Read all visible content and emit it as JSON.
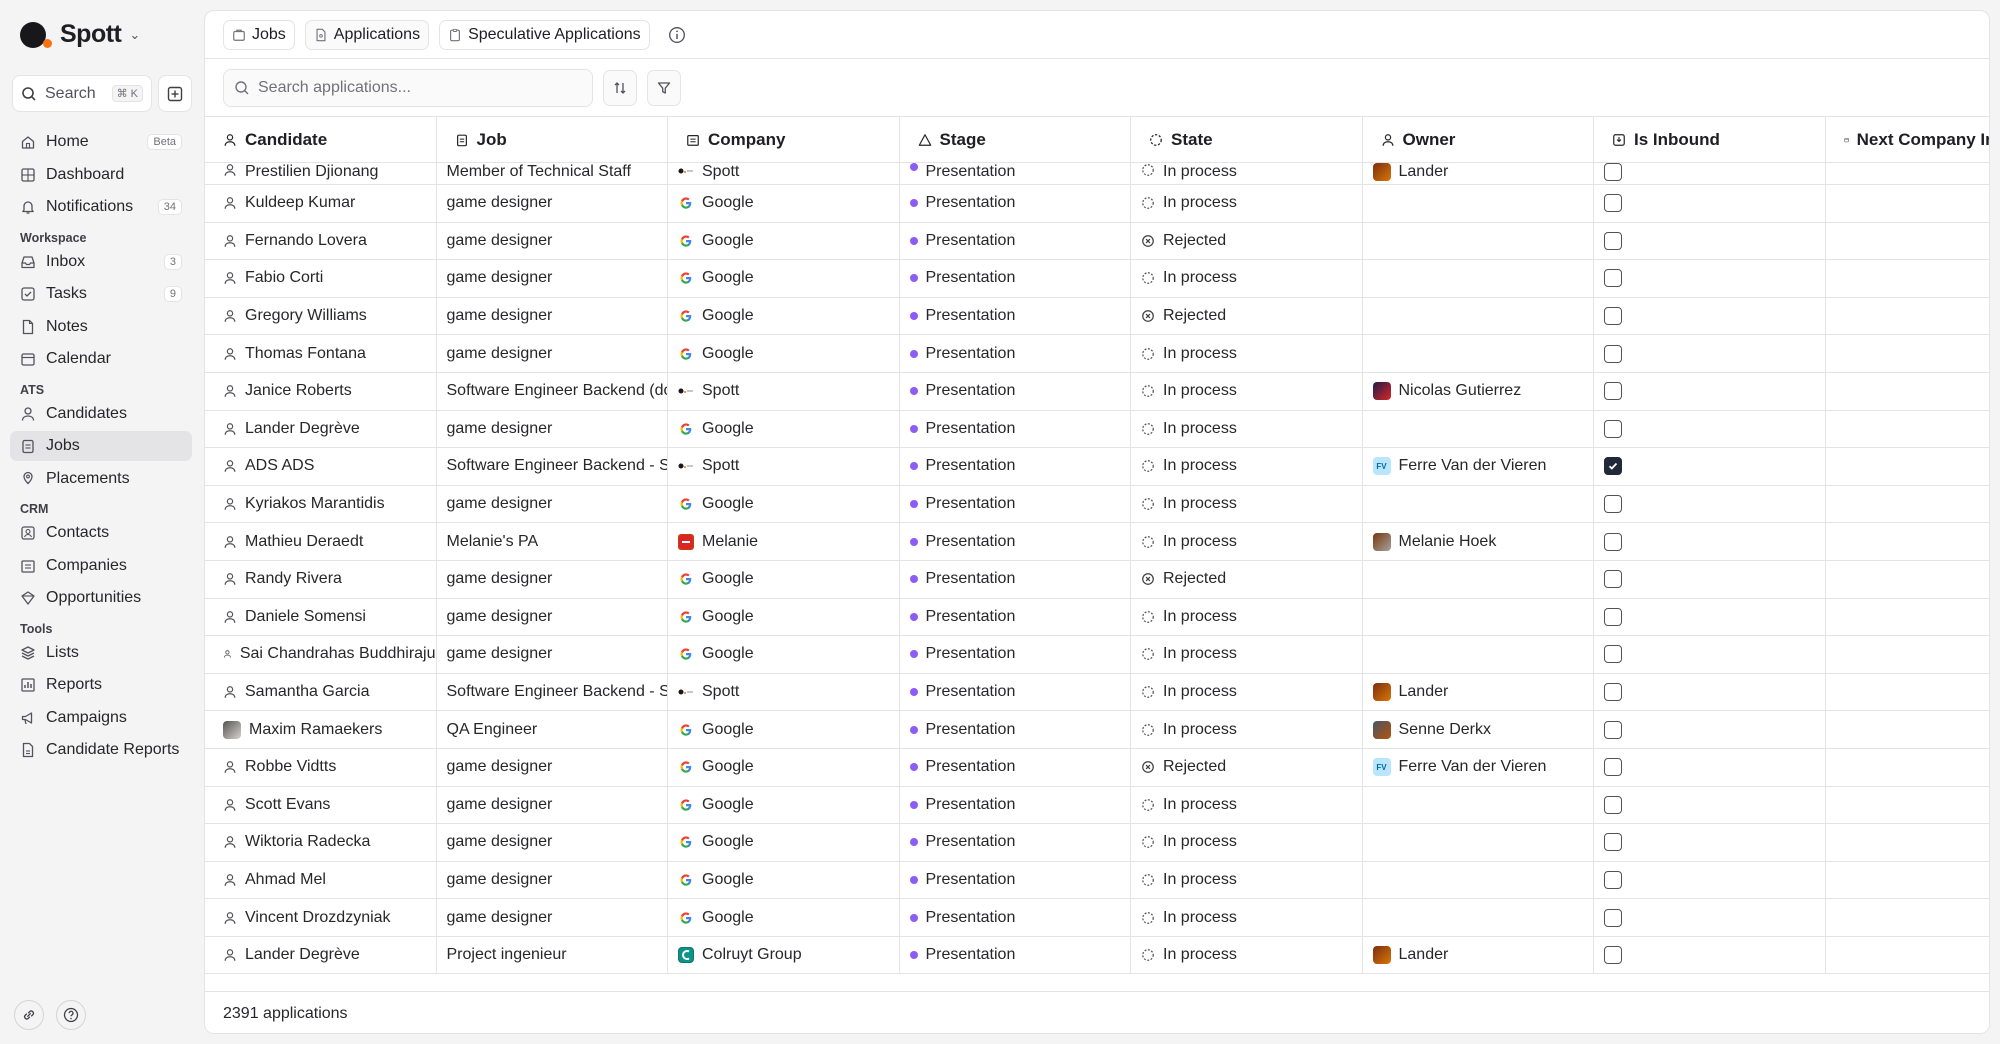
{
  "brand": {
    "name": "Spott"
  },
  "sidebar": {
    "search_label": "Search",
    "search_shortcut": "⌘ K",
    "items_top": [
      {
        "label": "Home",
        "badge": "Beta",
        "icon": "home-icon"
      },
      {
        "label": "Dashboard",
        "badge": "",
        "icon": "dashboard-icon"
      },
      {
        "label": "Notifications",
        "badge": "34",
        "icon": "bell-icon"
      }
    ],
    "sections": [
      {
        "title": "Workspace",
        "items": [
          {
            "label": "Inbox",
            "badge": "3"
          },
          {
            "label": "Tasks",
            "badge": "9"
          },
          {
            "label": "Notes",
            "badge": ""
          },
          {
            "label": "Calendar",
            "badge": ""
          }
        ]
      },
      {
        "title": "ATS",
        "items": [
          {
            "label": "Candidates",
            "badge": ""
          },
          {
            "label": "Jobs",
            "badge": "",
            "active": true
          },
          {
            "label": "Placements",
            "badge": ""
          }
        ]
      },
      {
        "title": "CRM",
        "items": [
          {
            "label": "Contacts",
            "badge": ""
          },
          {
            "label": "Companies",
            "badge": ""
          },
          {
            "label": "Opportunities",
            "badge": ""
          }
        ]
      },
      {
        "title": "Tools",
        "items": [
          {
            "label": "Lists",
            "badge": ""
          },
          {
            "label": "Reports",
            "badge": ""
          },
          {
            "label": "Campaigns",
            "badge": ""
          },
          {
            "label": "Candidate Reports",
            "badge": ""
          }
        ]
      }
    ]
  },
  "tabs": [
    {
      "label": "Jobs"
    },
    {
      "label": "Applications"
    },
    {
      "label": "Speculative Applications"
    }
  ],
  "toolbar": {
    "search_placeholder": "Search applications..."
  },
  "columns": [
    "Candidate",
    "Job",
    "Company",
    "Stage",
    "State",
    "Owner",
    "Is Inbound",
    "Next Company In"
  ],
  "rows": [
    {
      "candidate": "Prestilien Djionang",
      "job": "Member of Technical Staff",
      "company": "Spott",
      "logo": "spott",
      "stage": "Presentation",
      "state": "In process",
      "owner": "Lander",
      "owner_avatar": "photo1",
      "inbound": false
    },
    {
      "candidate": "Kuldeep Kumar",
      "job": "game designer",
      "company": "Google",
      "logo": "google",
      "stage": "Presentation",
      "state": "In process",
      "owner": "",
      "owner_avatar": "",
      "inbound": false
    },
    {
      "candidate": "Fernando Lovera",
      "job": "game designer",
      "company": "Google",
      "logo": "google",
      "stage": "Presentation",
      "state": "Rejected",
      "owner": "",
      "owner_avatar": "",
      "inbound": false
    },
    {
      "candidate": "Fabio Corti",
      "job": "game designer",
      "company": "Google",
      "logo": "google",
      "stage": "Presentation",
      "state": "In process",
      "owner": "",
      "owner_avatar": "",
      "inbound": false
    },
    {
      "candidate": "Gregory Williams",
      "job": "game designer",
      "company": "Google",
      "logo": "google",
      "stage": "Presentation",
      "state": "Rejected",
      "owner": "",
      "owner_avatar": "",
      "inbound": false
    },
    {
      "candidate": "Thomas Fontana",
      "job": "game designer",
      "company": "Google",
      "logo": "google",
      "stage": "Presentation",
      "state": "In process",
      "owner": "",
      "owner_avatar": "",
      "inbound": false
    },
    {
      "candidate": "Janice Roberts",
      "job": "Software Engineer Backend (do",
      "company": "Spott",
      "logo": "spott",
      "stage": "Presentation",
      "state": "In process",
      "owner": "Nicolas Gutierrez",
      "owner_avatar": "photo2",
      "inbound": false
    },
    {
      "candidate": "Lander Degrève",
      "job": "game designer",
      "company": "Google",
      "logo": "google",
      "stage": "Presentation",
      "state": "In process",
      "owner": "",
      "owner_avatar": "",
      "inbound": false
    },
    {
      "candidate": "ADS ADS",
      "job": "Software Engineer Backend - S",
      "company": "Spott",
      "logo": "spott",
      "stage": "Presentation",
      "state": "In process",
      "owner": "Ferre Van der Vieren",
      "owner_avatar": "FV",
      "inbound": true
    },
    {
      "candidate": "Kyriakos Marantidis",
      "job": "game designer",
      "company": "Google",
      "logo": "google",
      "stage": "Presentation",
      "state": "In process",
      "owner": "",
      "owner_avatar": "",
      "inbound": false
    },
    {
      "candidate": "Mathieu Deraedt",
      "job": "Melanie's PA",
      "company": "Melanie",
      "logo": "melanie",
      "stage": "Presentation",
      "state": "In process",
      "owner": "Melanie Hoek",
      "owner_avatar": "photo3",
      "inbound": false
    },
    {
      "candidate": "Randy Rivera",
      "job": "game designer",
      "company": "Google",
      "logo": "google",
      "stage": "Presentation",
      "state": "Rejected",
      "owner": "",
      "owner_avatar": "",
      "inbound": false
    },
    {
      "candidate": "Daniele Somensi",
      "job": "game designer",
      "company": "Google",
      "logo": "google",
      "stage": "Presentation",
      "state": "In process",
      "owner": "",
      "owner_avatar": "",
      "inbound": false
    },
    {
      "candidate": "Sai Chandrahas Buddhiraju",
      "job": "game designer",
      "company": "Google",
      "logo": "google",
      "stage": "Presentation",
      "state": "In process",
      "owner": "",
      "owner_avatar": "",
      "inbound": false
    },
    {
      "candidate": "Samantha Garcia",
      "job": "Software Engineer Backend - S",
      "company": "Spott",
      "logo": "spott",
      "stage": "Presentation",
      "state": "In process",
      "owner": "Lander",
      "owner_avatar": "photo1",
      "inbound": false
    },
    {
      "candidate": "Maxim Ramaekers",
      "job": "QA Engineer",
      "company": "Google",
      "logo": "google",
      "stage": "Presentation",
      "state": "In process",
      "owner": "Senne Derkx",
      "owner_avatar": "photo4",
      "inbound": false,
      "candidate_photo": true
    },
    {
      "candidate": "Robbe Vidtts",
      "job": "game designer",
      "company": "Google",
      "logo": "google",
      "stage": "Presentation",
      "state": "Rejected",
      "owner": "Ferre Van der Vieren",
      "owner_avatar": "FV",
      "inbound": false
    },
    {
      "candidate": "Scott Evans",
      "job": "game designer",
      "company": "Google",
      "logo": "google",
      "stage": "Presentation",
      "state": "In process",
      "owner": "",
      "owner_avatar": "",
      "inbound": false
    },
    {
      "candidate": "Wiktoria Radecka",
      "job": "game designer",
      "company": "Google",
      "logo": "google",
      "stage": "Presentation",
      "state": "In process",
      "owner": "",
      "owner_avatar": "",
      "inbound": false
    },
    {
      "candidate": "Ahmad Mel",
      "job": "game designer",
      "company": "Google",
      "logo": "google",
      "stage": "Presentation",
      "state": "In process",
      "owner": "",
      "owner_avatar": "",
      "inbound": false
    },
    {
      "candidate": "Vincent Drozdzyniak",
      "job": "game designer",
      "company": "Google",
      "logo": "google",
      "stage": "Presentation",
      "state": "In process",
      "owner": "",
      "owner_avatar": "",
      "inbound": false
    },
    {
      "candidate": "Lander Degrève",
      "job": "Project ingenieur",
      "company": "Colruyt Group",
      "logo": "colruyt",
      "stage": "Presentation",
      "state": "In process",
      "owner": "Lander",
      "owner_avatar": "photo1",
      "inbound": false
    }
  ],
  "footer": {
    "count_text": "2391 applications"
  },
  "colors": {
    "stage_dot": "#8b5cf6",
    "accent_dark": "#1f2937"
  }
}
